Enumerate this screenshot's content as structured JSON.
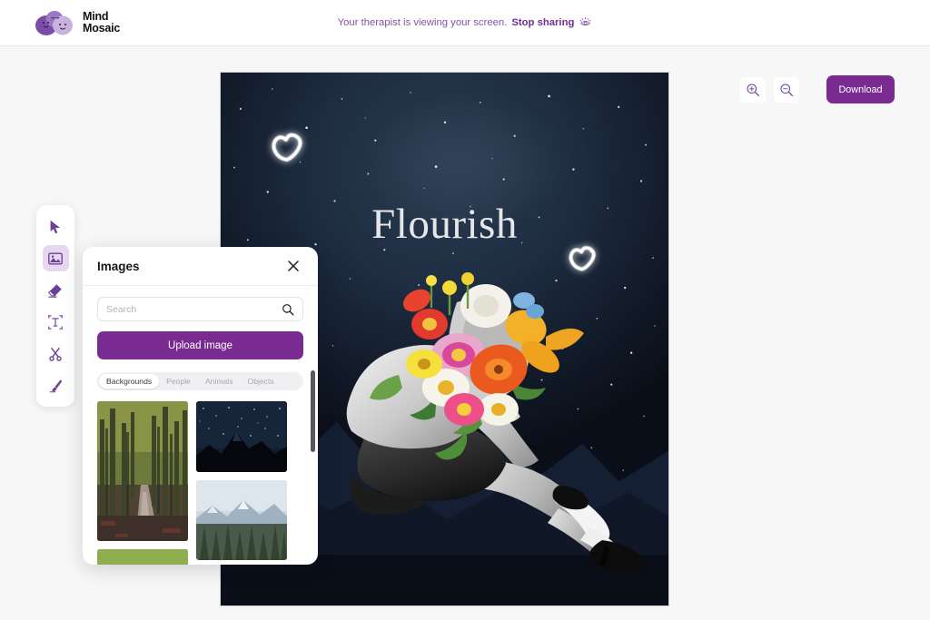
{
  "app": {
    "brand_name": "Mind\nMosaic",
    "accent_purple": "#7a2b92",
    "logo_icon": "mind-mosaic-blobs-logo"
  },
  "header": {
    "share_message": "Your therapist is viewing your screen.",
    "stop_sharing_label": "Stop sharing",
    "eye_icon": "screen-share-eye-icon"
  },
  "canvas": {
    "artwork_title": "Flourish",
    "background_description": "starry-night-sky-with-mountains",
    "decorations": [
      "glowing-heart-doodle",
      "glowing-heart-doodle"
    ],
    "collage_description": "black-and-white-seated-figure-with-floral-bouquet-head"
  },
  "controls": {
    "zoom_in_icon": "zoom-in-icon",
    "zoom_out_icon": "zoom-out-icon",
    "download_label": "Download"
  },
  "toolbar": {
    "tools": [
      {
        "id": "select",
        "icon": "cursor-arrow-icon",
        "active": false
      },
      {
        "id": "image",
        "icon": "image-icon",
        "active": true
      },
      {
        "id": "eraser",
        "icon": "eraser-icon",
        "active": false
      },
      {
        "id": "text",
        "icon": "text-icon",
        "active": false
      },
      {
        "id": "cut",
        "icon": "scissors-icon",
        "active": false
      },
      {
        "id": "brush",
        "icon": "brush-icon",
        "active": false
      }
    ]
  },
  "panel": {
    "title": "Images",
    "close_icon": "close-icon",
    "search": {
      "placeholder": "Search",
      "value": "",
      "icon": "search-icon"
    },
    "upload_label": "Upload image",
    "tabs": [
      {
        "label": "Backgrounds",
        "active": true
      },
      {
        "label": "People",
        "active": false
      },
      {
        "label": "Animals",
        "active": false
      },
      {
        "label": "Objects",
        "active": false
      }
    ],
    "thumbnails": [
      {
        "id": "forest-road",
        "description": "autumn-forest-path"
      },
      {
        "id": "starry-mountains",
        "description": "night-sky-over-dark-mountain-peaks"
      },
      {
        "id": "misty-forest-mountains",
        "description": "pine-forest-with-snowy-mountains"
      },
      {
        "id": "green-meadow",
        "description": "green-field-partial"
      }
    ]
  }
}
